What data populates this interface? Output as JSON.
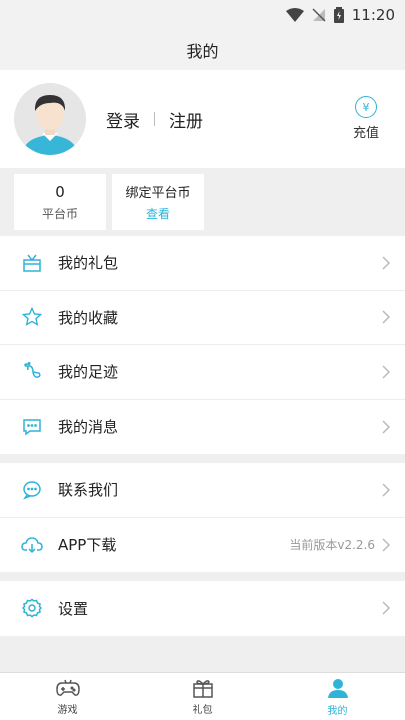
{
  "status": {
    "time": "11:20"
  },
  "header": {
    "title": "我的"
  },
  "profile": {
    "login_label": "登录",
    "register_label": "注册",
    "recharge_label": "充值",
    "recharge_symbol": "¥"
  },
  "coins": [
    {
      "value": "0",
      "label": "平台币"
    },
    {
      "title": "绑定平台币",
      "link": "查看"
    }
  ],
  "menu_group_1": [
    {
      "label": "我的礼包",
      "icon": "gift-icon"
    },
    {
      "label": "我的收藏",
      "icon": "star-icon"
    },
    {
      "label": "我的足迹",
      "icon": "footprint-icon"
    },
    {
      "label": "我的消息",
      "icon": "message-icon"
    }
  ],
  "menu_group_2": [
    {
      "label": "联系我们",
      "icon": "chat-icon"
    },
    {
      "label": "APP下载",
      "icon": "cloud-download-icon",
      "extra": "当前版本v2.2.6"
    }
  ],
  "menu_group_3": [
    {
      "label": "设置",
      "icon": "gear-icon"
    }
  ],
  "tabbar": [
    {
      "label": "游戏",
      "icon": "gamepad-icon"
    },
    {
      "label": "礼包",
      "icon": "gift-box-icon"
    },
    {
      "label": "我的",
      "icon": "user-icon",
      "active": true
    }
  ],
  "colors": {
    "accent": "#2fb3d6",
    "background": "#efefef"
  }
}
